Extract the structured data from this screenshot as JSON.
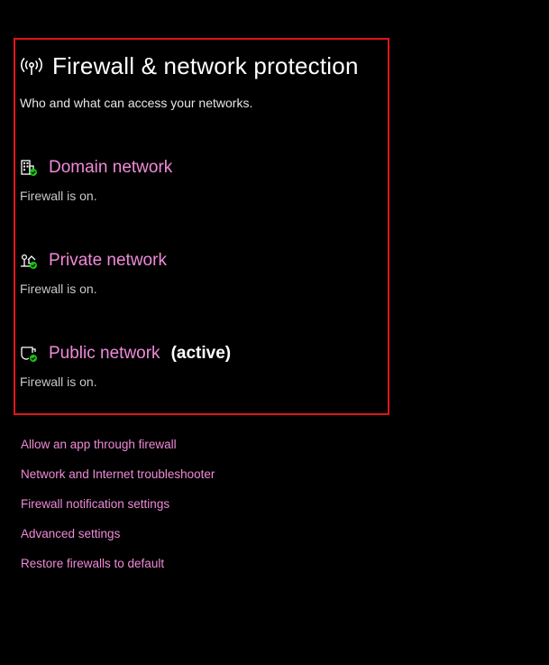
{
  "header": {
    "title": "Firewall & network protection",
    "subtitle": "Who and what can access your networks.",
    "icon": "wireless-antenna-icon"
  },
  "networks": [
    {
      "label": "Domain network",
      "status": "Firewall is on.",
      "icon": "building-icon",
      "active_label": ""
    },
    {
      "label": "Private network",
      "status": "Firewall is on.",
      "icon": "home-network-icon",
      "active_label": ""
    },
    {
      "label": "Public network",
      "status": "Firewall is on.",
      "icon": "public-network-icon",
      "active_label": "(active)"
    }
  ],
  "links": [
    "Allow an app through firewall",
    "Network and Internet troubleshooter",
    "Firewall notification settings",
    "Advanced settings",
    "Restore firewalls to default"
  ],
  "colors": {
    "background": "#000000",
    "link": "#f08ad8",
    "highlight_border": "#e0141b",
    "status_ok": "#16c60c"
  }
}
